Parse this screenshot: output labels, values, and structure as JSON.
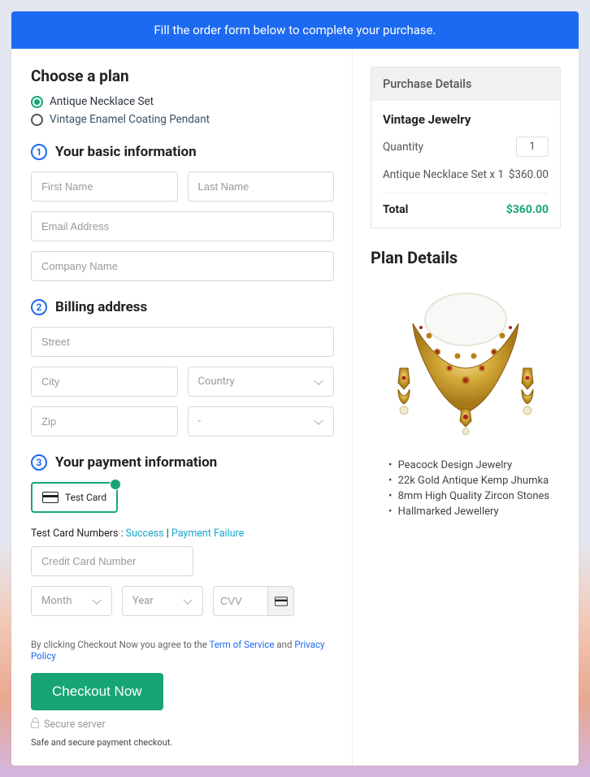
{
  "banner": "Fill the order form below to complete your purchase.",
  "choose_plan": {
    "title": "Choose a plan",
    "options": [
      "Antique Necklace Set",
      "Vintage Enamel Coating Pendant"
    ]
  },
  "section1": {
    "num": "1",
    "title": "Your basic information"
  },
  "fields": {
    "first_name": "First Name",
    "last_name": "Last Name",
    "email": "Email Address",
    "company": "Company Name"
  },
  "section2": {
    "num": "2",
    "title": "Billing address"
  },
  "billing": {
    "street": "Street",
    "city": "City",
    "country": "Country",
    "zip": "Zip",
    "state": "-"
  },
  "section3": {
    "num": "3",
    "title": "Your payment information"
  },
  "payment": {
    "test_card": "Test Card",
    "hint_prefix": "Test Card Numbers : ",
    "success": "Success",
    "sep": " | ",
    "failure": "Payment Failure",
    "cc_placeholder": "Credit Card Number",
    "month": "Month",
    "year": "Year",
    "cvv": "CVV"
  },
  "agree": {
    "prefix": "By clicking Checkout Now you agree to the ",
    "tos": "Term of Service",
    "mid": " and ",
    "pp": "Privacy Policy"
  },
  "checkout": "Checkout Now",
  "secure": "Secure server",
  "safe": "Safe and secure payment checkout.",
  "purchase": {
    "header": "Purchase Details",
    "title": "Vintage Jewelry",
    "qty_label": "Quantity",
    "qty": "1",
    "line_item": "Antique Necklace Set x 1",
    "line_price": "$360.00",
    "total_label": "Total",
    "total": "$360.00"
  },
  "plan_details": {
    "title": "Plan Details",
    "bullets": [
      "Peacock Design Jewelry",
      "22k Gold Antique Kemp Jhumka",
      "8mm High Quality Zircon Stones",
      "Hallmarked Jewellery"
    ]
  }
}
